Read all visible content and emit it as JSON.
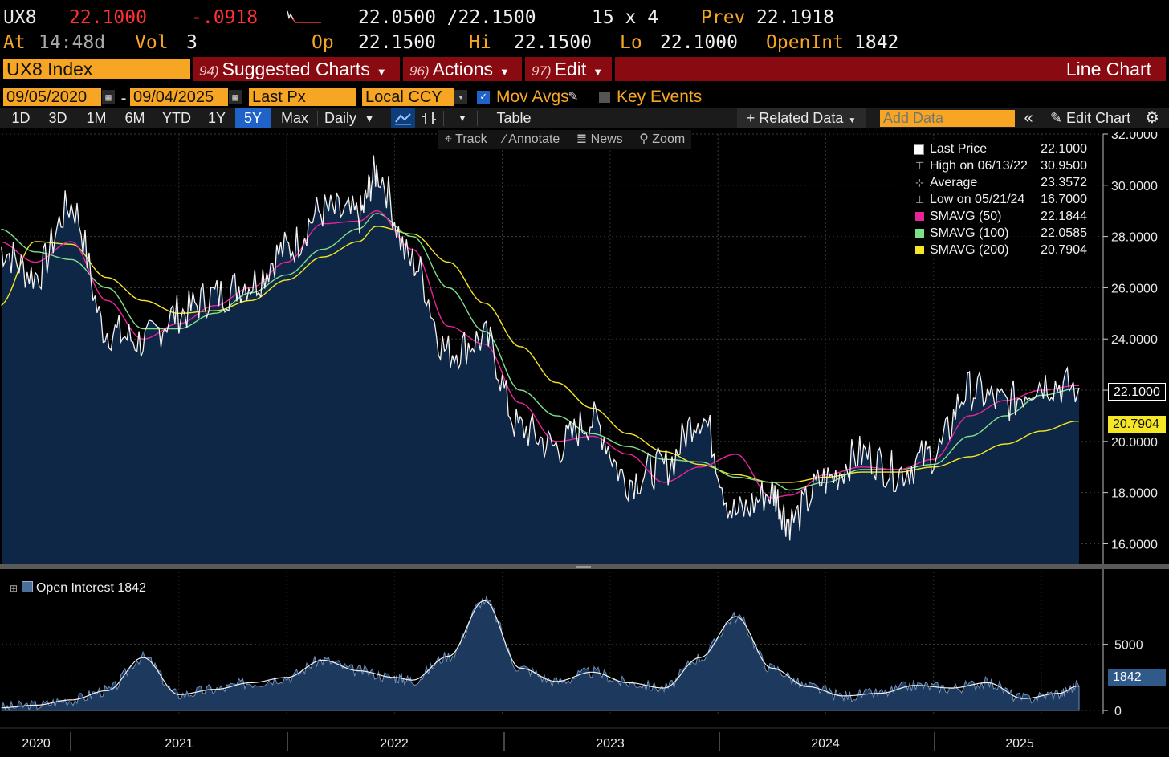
{
  "quote": {
    "ticker": "UX8",
    "last": "22.1000",
    "change": "-.0918",
    "bid_ask": "22.0500 /22.1500",
    "size": "15 x 4",
    "prev_label": "Prev",
    "prev": "22.1918",
    "at_label": "At",
    "time": "14:48d",
    "vol_label": "Vol",
    "vol": "3",
    "op_label": "Op",
    "op": "22.1500",
    "hi_label": "Hi",
    "hi": "22.1500",
    "lo_label": "Lo",
    "lo": "22.1000",
    "openint_label": "OpenInt",
    "openint": "1842"
  },
  "menu": {
    "security": "UX8 Index",
    "suggested_num": "94)",
    "suggested": "Suggested Charts",
    "actions_num": "96)",
    "actions": "Actions",
    "edit_num": "97)",
    "edit": "Edit",
    "chart_type": "Line Chart"
  },
  "params": {
    "start_date": "09/05/2020",
    "end_date": "09/04/2025",
    "dash": "-",
    "field": "Last Px",
    "currency": "Local CCY",
    "mov_avgs": "Mov Avgs",
    "key_events": "Key Events"
  },
  "toolbar": {
    "ranges": [
      "1D",
      "3D",
      "1M",
      "6M",
      "YTD",
      "1Y",
      "5Y",
      "Max"
    ],
    "selected_range": "5Y",
    "frequency": "Daily",
    "table": "Table",
    "related_data": "+ Related Data",
    "add_data_placeholder": "Add Data",
    "edit_chart": "Edit Chart"
  },
  "tools": [
    "Track",
    "Annotate",
    "News",
    "Zoom"
  ],
  "legend": [
    {
      "label": "Last Price",
      "value": "22.1000",
      "color": "#ffffff",
      "icon": "square"
    },
    {
      "label": "High on 06/13/22",
      "value": "30.9500",
      "color": "",
      "icon": "high-marker"
    },
    {
      "label": "Average",
      "value": "23.3572",
      "color": "",
      "icon": "average-marker"
    },
    {
      "label": "Low on 05/21/24",
      "value": "16.7000",
      "color": "",
      "icon": "low-marker"
    },
    {
      "label": "SMAVG (50)",
      "value": "22.1844",
      "color": "#e8249b",
      "icon": "square"
    },
    {
      "label": "SMAVG (100)",
      "value": "22.0585",
      "color": "#7fe08a",
      "icon": "square"
    },
    {
      "label": "SMAVG (200)",
      "value": "20.7904",
      "color": "#f5e626",
      "icon": "square"
    }
  ],
  "price_tags": {
    "last": "22.1000",
    "sma200": "20.7904",
    "oi": "1842"
  },
  "oi_legend": "Open Interest 1842",
  "colors": {
    "orange": "#f6a623",
    "red": "#ff3030",
    "menu_bar": "#8a0a12",
    "area_fill": "#0e2746",
    "oi_fill": "#1d3a5e",
    "sma50": "#e8249b",
    "sma100": "#7fe08a",
    "sma200": "#f5e626",
    "selected": "#1f63c9"
  },
  "chart_data": [
    {
      "type": "line",
      "title": "UX8 Index",
      "series_units": "price",
      "x_labels": [
        "2020",
        "2021",
        "2022",
        "2023",
        "2024",
        "2025"
      ],
      "y_ticks": [
        16,
        18,
        20,
        22,
        24,
        26,
        28,
        30,
        32
      ],
      "ylim": [
        15.2,
        32
      ],
      "x": [
        "2020-09",
        "2020-11",
        "2021-01",
        "2021-03",
        "2021-05",
        "2021-07",
        "2021-09",
        "2021-11",
        "2022-01",
        "2022-03",
        "2022-05",
        "2022-06",
        "2022-08",
        "2022-10",
        "2022-12",
        "2023-02",
        "2023-04",
        "2023-06",
        "2023-08",
        "2023-10",
        "2023-12",
        "2024-02",
        "2024-04",
        "2024-05",
        "2024-07",
        "2024-09",
        "2024-11",
        "2025-01",
        "2025-03",
        "2025-05",
        "2025-07",
        "2025-09"
      ],
      "series": [
        {
          "name": "Last Price",
          "values": [
            27.5,
            26.5,
            29.2,
            24.3,
            23.9,
            25.0,
            25.7,
            26.2,
            27.5,
            29.0,
            28.8,
            30.5,
            27.0,
            23.5,
            24.0,
            20.5,
            19.8,
            20.8,
            18.5,
            19.0,
            21.0,
            17.2,
            18.0,
            16.9,
            18.5,
            19.5,
            18.8,
            19.5,
            22.0,
            21.5,
            22.3,
            22.1
          ]
        },
        {
          "name": "SMAVG (50)",
          "values": [
            27.8,
            27.0,
            27.8,
            25.5,
            24.0,
            24.6,
            25.3,
            26.0,
            27.0,
            28.5,
            28.6,
            29.0,
            27.5,
            24.5,
            23.8,
            21.5,
            20.0,
            20.2,
            19.5,
            18.4,
            19.0,
            19.5,
            17.8,
            17.9,
            18.7,
            19.0,
            18.9,
            19.3,
            21.0,
            21.6,
            22.0,
            22.18
          ]
        },
        {
          "name": "SMAVG (100)",
          "values": [
            28.3,
            27.4,
            27.1,
            26.0,
            24.4,
            24.4,
            25.0,
            25.8,
            26.5,
            27.5,
            28.3,
            28.9,
            28.0,
            26.0,
            24.3,
            22.0,
            21.0,
            20.3,
            19.8,
            19.3,
            19.2,
            18.6,
            18.4,
            18.1,
            18.4,
            18.9,
            18.9,
            19.1,
            20.2,
            21.0,
            21.8,
            22.06
          ]
        },
        {
          "name": "SMAVG (200)",
          "values": [
            25.3,
            27.8,
            27.7,
            26.4,
            25.5,
            25.0,
            25.1,
            25.5,
            26.3,
            27.2,
            27.8,
            28.4,
            28.1,
            27.0,
            25.4,
            23.7,
            22.3,
            21.3,
            20.3,
            19.6,
            19.1,
            18.7,
            18.4,
            18.4,
            18.6,
            18.8,
            18.8,
            19.0,
            19.4,
            19.9,
            20.4,
            20.79
          ]
        }
      ]
    },
    {
      "type": "area",
      "title": "Open Interest",
      "y_ticks": [
        0,
        5000
      ],
      "ylim": [
        -300,
        10500
      ],
      "x": [
        "2020-09",
        "2020-11",
        "2021-01",
        "2021-03",
        "2021-05",
        "2021-07",
        "2021-09",
        "2021-11",
        "2022-01",
        "2022-03",
        "2022-05",
        "2022-07",
        "2022-08",
        "2022-10",
        "2022-12",
        "2023-02",
        "2023-04",
        "2023-06",
        "2023-08",
        "2023-10",
        "2023-12",
        "2024-02",
        "2024-04",
        "2024-06",
        "2024-08",
        "2024-10",
        "2024-12",
        "2025-02",
        "2025-04",
        "2025-06",
        "2025-08",
        "2025-09"
      ],
      "values": [
        200,
        400,
        800,
        1500,
        4000,
        1200,
        1600,
        2100,
        2500,
        3800,
        3000,
        2500,
        2300,
        4100,
        8300,
        3200,
        2200,
        2900,
        2100,
        1700,
        4000,
        7100,
        3200,
        1800,
        1100,
        1300,
        1900,
        1700,
        2100,
        900,
        1300,
        1842
      ]
    }
  ]
}
